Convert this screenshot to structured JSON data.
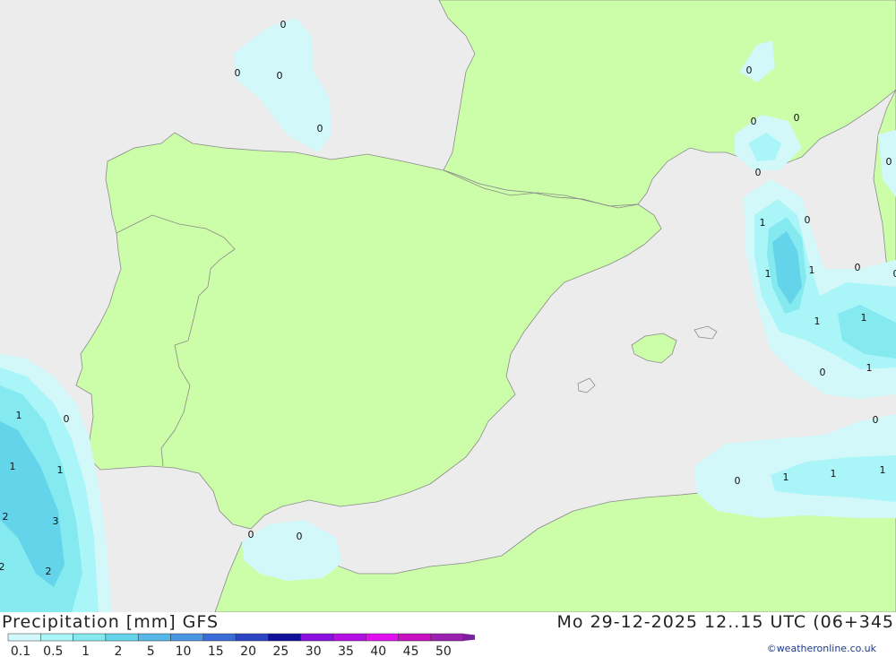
{
  "header": {
    "title": "Precipitation [mm] GFS",
    "valid": "Mo 29-12-2025 12..15 UTC (06+345",
    "credit": "©weatheronline.co.uk"
  },
  "legend": {
    "ticks": [
      "0.1",
      "0.5",
      "1",
      "2",
      "5",
      "10",
      "15",
      "20",
      "25",
      "30",
      "35",
      "40",
      "45",
      "50"
    ],
    "colors": [
      "#d2f8fa",
      "#aaf5f8",
      "#84eaf0",
      "#63d4ea",
      "#56b8e6",
      "#4a96e2",
      "#3a6cd8",
      "#2a44c4",
      "#10109a",
      "#8a10e0",
      "#b410e6",
      "#e010f0",
      "#c810c0",
      "#9a20b0"
    ]
  },
  "colors": {
    "sea": "#ececec",
    "land": "#ccfda8",
    "border": "#8a8a8a"
  },
  "map_labels": [
    "0",
    "0",
    "0",
    "0",
    "0",
    "0",
    "0",
    "0",
    "0",
    "0",
    "1",
    "0",
    "1",
    "1",
    "0",
    "1",
    "1",
    "0",
    "1",
    "0",
    "1",
    "0",
    "1",
    "1",
    "1",
    "0",
    "1",
    "1",
    "2",
    "3",
    "2",
    "2",
    "0",
    "0"
  ]
}
